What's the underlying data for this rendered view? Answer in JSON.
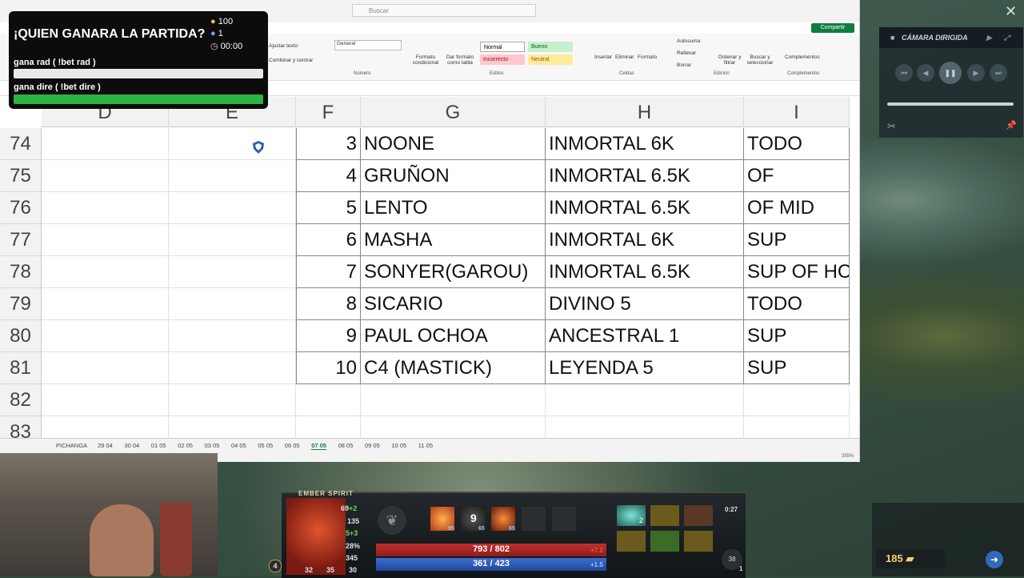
{
  "excel": {
    "search_placeholder": "Buscar",
    "share_label": "Compartir",
    "ribbon": {
      "wrap_text": "Ajustar texto",
      "merge_center": "Combinar y centrar",
      "number_format": "General",
      "group_number": "Número",
      "conditional_format": "Formato condicional",
      "format_table": "Dar formato como tabla",
      "styles": [
        "Normal",
        "Bueno",
        "Incorrecto",
        "Neutral"
      ],
      "group_styles": "Estilos",
      "insert": "Insertar",
      "delete": "Eliminar",
      "format": "Formato",
      "group_cells": "Celdas",
      "autosum": "Autosuma",
      "fill": "Rellenar",
      "clear": "Borrar",
      "sort_filter": "Ordenar y filtrar",
      "find_select": "Buscar y seleccionar",
      "group_editing": "Edición",
      "addins": "Complementos",
      "group_addins": "Complementos"
    },
    "columns": [
      "D",
      "E",
      "F",
      "G",
      "H",
      "I"
    ],
    "rows": [
      {
        "row": "74",
        "f": "3",
        "g": "NOONE",
        "h": "INMORTAL 6K",
        "i": "TODO"
      },
      {
        "row": "75",
        "f": "4",
        "g": "GRUÑON",
        "h": "INMORTAL 6.5K",
        "i": "OF"
      },
      {
        "row": "76",
        "f": "5",
        "g": "LENTO",
        "h": "INMORTAL 6.5K",
        "i": "OF  MID"
      },
      {
        "row": "77",
        "f": "6",
        "g": "MASHA",
        "h": "INMORTAL 6K",
        "i": "SUP"
      },
      {
        "row": "78",
        "f": "7",
        "g": "SONYER(GAROU)",
        "h": "INMORTAL 6.5K",
        "i": "SUP OF HC"
      },
      {
        "row": "79",
        "f": "8",
        "g": "SICARIO",
        "h": "DIVINO 5",
        "i": "TODO"
      },
      {
        "row": "80",
        "f": "9",
        "g": "PAUL OCHOA",
        "h": "ANCESTRAL 1",
        "i": "SUP"
      },
      {
        "row": "81",
        "f": "10",
        "g": "C4 (MASTICK)",
        "h": "LEYENDA 5",
        "i": "SUP"
      },
      {
        "row": "82",
        "f": "",
        "g": "",
        "h": "",
        "i": ""
      },
      {
        "row": "83",
        "f": "",
        "g": "",
        "h": "",
        "i": ""
      }
    ],
    "sheet_tabs": [
      "PICHANGA",
      "29 04",
      "30 04",
      "01 05",
      "02 05",
      "03 05",
      "04 05",
      "05 05",
      "06 05",
      "07 05",
      "08 05",
      "09 05",
      "10 05",
      "11 05"
    ],
    "active_tab": "07 05",
    "zoom": "355%"
  },
  "bet_overlay": {
    "title": "¡QUIEN GANARA LA PARTIDA?",
    "coins": "100",
    "users": "1",
    "timer": "00:00",
    "option_rad": "gana rad ( !bet rad )",
    "option_dire": "gana dire ( !bet dire )",
    "colors": {
      "dire_bar": "#2cb342",
      "rad_bar": "#e9e9e9"
    }
  },
  "camera_panel": {
    "title": "CÁMARA DIRIGIDA"
  },
  "hud": {
    "hero_name": "EMBER SPIRIT",
    "level": "4",
    "hp": "793 / 802",
    "mana": "361 / 423",
    "hp_regen": "+7.2",
    "mana_regen": "+1.5",
    "gold": "185",
    "game_time": "0:27",
    "stats": {
      "damage": "69",
      "damage_bonus": "+2",
      "armor": "135",
      "speed": "5",
      "speed_bonus": "+3",
      "magic_res": "28%",
      "move_speed": "345",
      "attack_range": "30"
    },
    "attributes": {
      "str": "32",
      "agi": "35",
      "int": "30"
    },
    "ability_levels": [
      "95",
      "65",
      "65"
    ],
    "ability_charge": "9",
    "item_charges": "2",
    "courier_count": "38",
    "courier_sub": "1"
  }
}
